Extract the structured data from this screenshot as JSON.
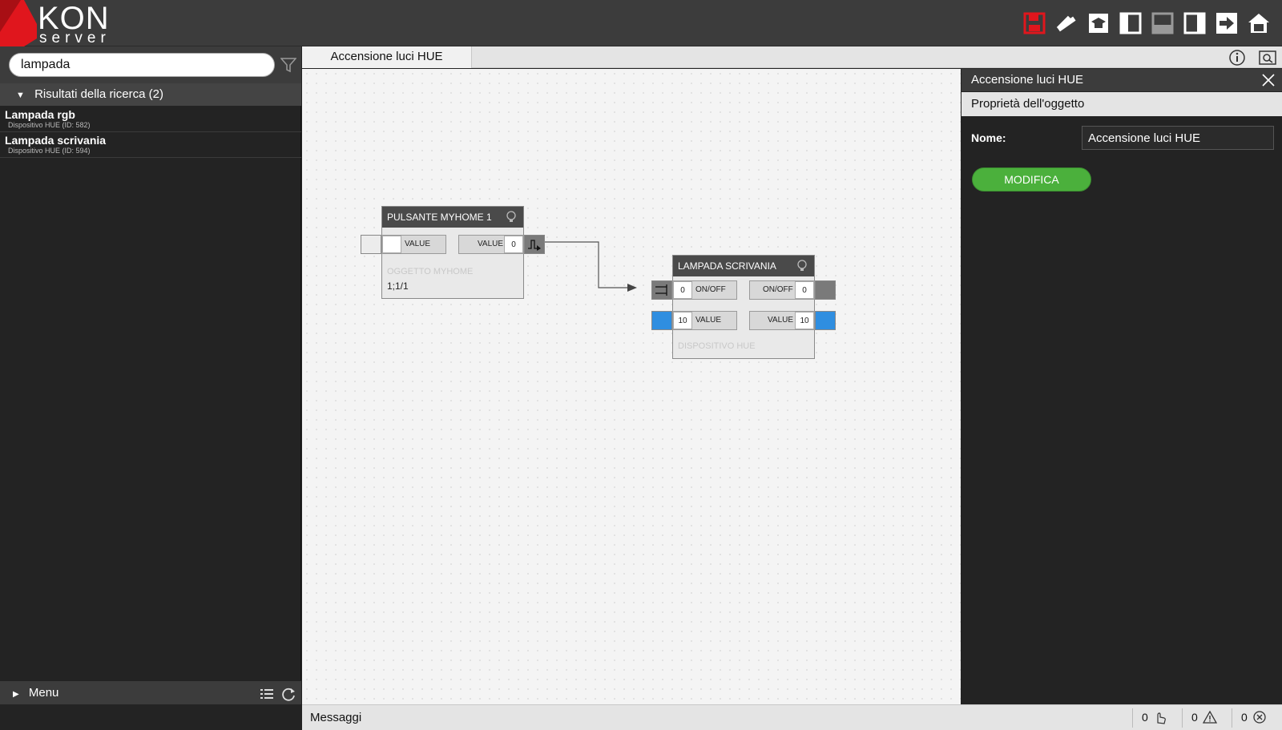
{
  "app": {
    "logo_title": "KON",
    "logo_sub": "server",
    "brand_color": "#e0161d"
  },
  "toolbar": {
    "icons": [
      "save-icon",
      "tools-icon",
      "tutorial-icon",
      "left-panel-icon",
      "bottom-panel-icon",
      "right-panel-icon",
      "exit-icon",
      "home-icon"
    ]
  },
  "sidebar": {
    "search_value": "lampada",
    "results_header": "Risultati della ricerca (2)",
    "results": [
      {
        "title": "Lampada rgb",
        "subtitle": "Dispositivo HUE (ID: 582)"
      },
      {
        "title": "Lampada scrivania",
        "subtitle": "Dispositivo HUE (ID: 594)"
      }
    ],
    "menu_label": "Menu"
  },
  "tabs": [
    {
      "label": "Accensione luci HUE"
    }
  ],
  "nodes": {
    "node1": {
      "title": "PULSANTE MYHOME 1",
      "in_label": "VALUE",
      "out_label": "VALUE",
      "out_value": "0",
      "footer_label": "OGGETTO MYHOME",
      "footer_value": "1;1/1"
    },
    "node2": {
      "title": "LAMPADA SCRIVANIA",
      "in1_value": "0",
      "in1_label": "ON/OFF",
      "out1_label": "ON/OFF",
      "out1_value": "0",
      "in2_value": "10",
      "in2_label": "VALUE",
      "out2_label": "VALUE",
      "out2_value": "10",
      "footer_label": "DISPOSITIVO HUE",
      "accent": "#2f8ee0"
    }
  },
  "panel": {
    "title": "Accensione luci HUE",
    "subtitle": "Proprietà dell'oggetto",
    "name_label": "Nome:",
    "name_value": "Accensione luci HUE",
    "modify_label": "MODIFICA",
    "modify_color": "#4bb03c"
  },
  "statusbar": {
    "label": "Messaggi",
    "touch_count": "0",
    "warning_count": "0",
    "error_count": "0"
  }
}
